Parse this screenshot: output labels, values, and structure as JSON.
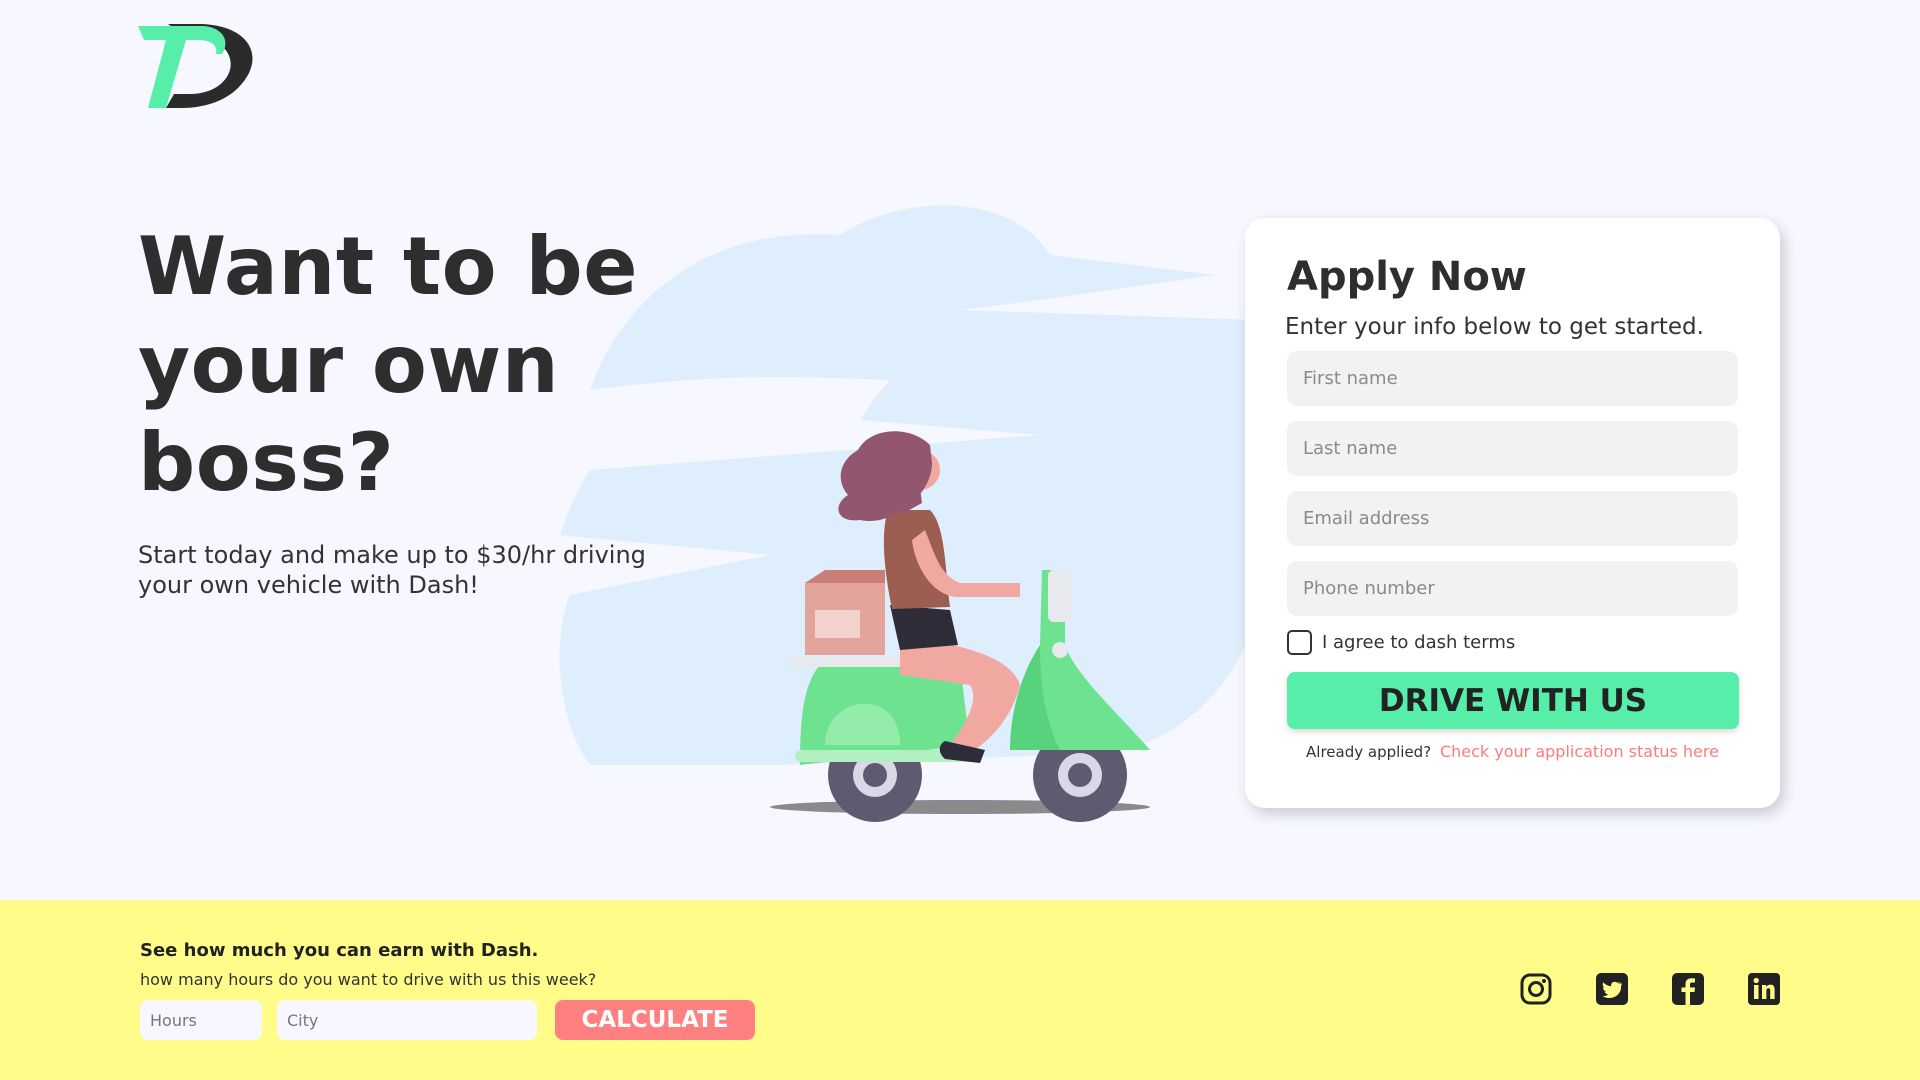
{
  "hero": {
    "title": "Want to be your own boss?",
    "subtitle": "Start today and make up to $30/hr driving your own vehicle with Dash!"
  },
  "apply": {
    "title": "Apply Now",
    "subtitle": "Enter your info below to get started.",
    "fields": {
      "first_name": "First name",
      "last_name": "Last name",
      "email": "Email address",
      "phone": "Phone number"
    },
    "agree_label": "I agree to dash terms",
    "agree_checked": false,
    "submit_label": "DRIVE WITH US",
    "already_text": "Already applied?",
    "status_link": "Check your application status here"
  },
  "earn": {
    "title": "See how much you can earn with Dash.",
    "question": "how many hours do you want to drive with us this week?",
    "hours_placeholder": "Hours",
    "city_placeholder": "City",
    "calculate_label": "CALCULATE"
  },
  "social_icons": [
    "instagram-icon",
    "twitter-icon",
    "facebook-icon",
    "linkedin-icon"
  ],
  "colors": {
    "background": "#f6f7ff",
    "accent_green": "#57eeaa",
    "accent_red": "#ff8080",
    "footer_yellow": "#fffc8a",
    "text_dark": "#2e2e2e"
  }
}
